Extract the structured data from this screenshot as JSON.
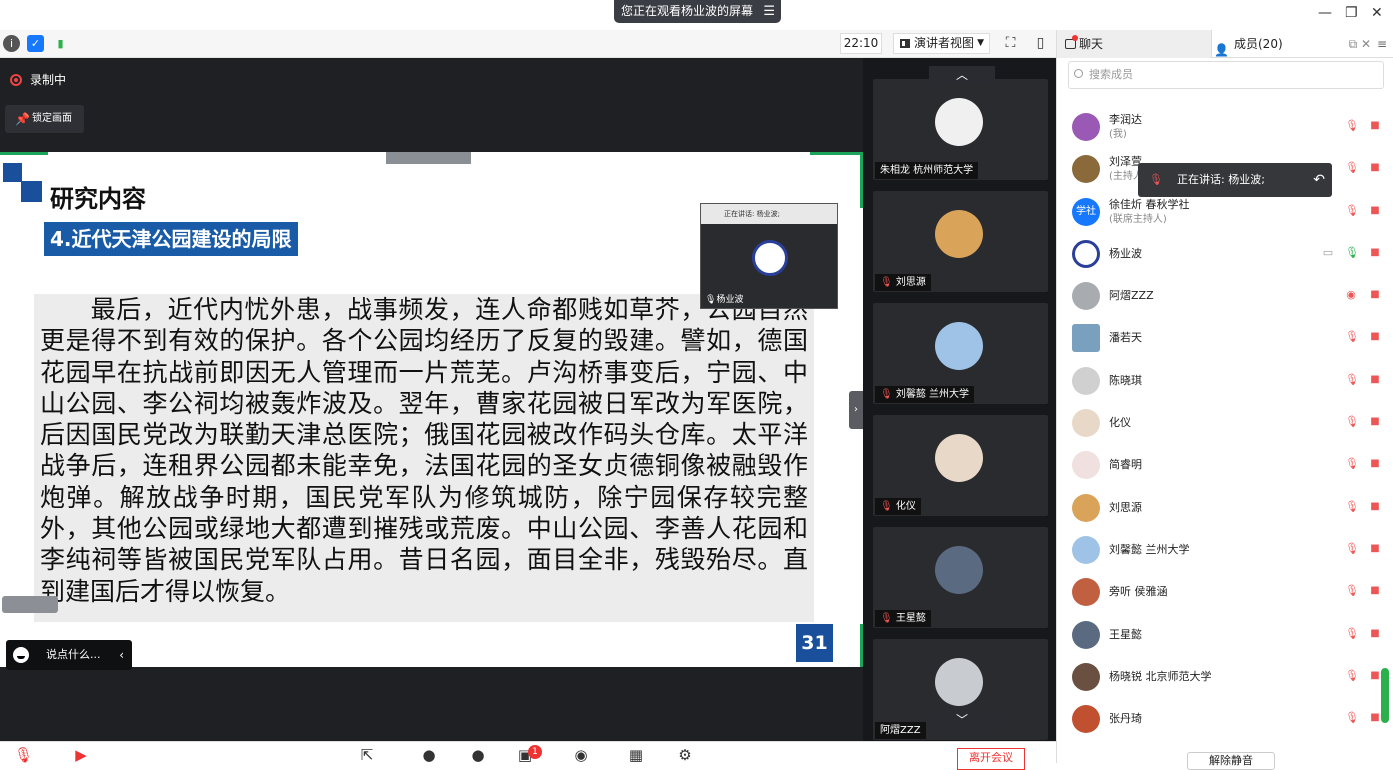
{
  "window": {
    "watching_banner": "您正在观看杨业波的屏幕",
    "menu_icon": "menu-icon",
    "minimize_icon": "minimize-icon",
    "restore_icon": "restore-icon",
    "close_icon": "close-icon"
  },
  "toolbar": {
    "time": "22:10",
    "view_mode": "演讲者视图",
    "icons": [
      "info-icon",
      "shield-icon",
      "signal-icon",
      "fullscreen-icon",
      "sidebar-toggle-icon"
    ]
  },
  "stage": {
    "recording_label": "录制中",
    "lock_label": "锁定画面",
    "chat_placeholder": "说点什么..."
  },
  "slide": {
    "title": "研究内容",
    "subtitle": "4.近代天津公园建设的局限",
    "body": "最后，近代内忧外患，战事频发，连人命都贱如草芥，公园自然更是得不到有效的保护。各个公园均经历了反复的毁建。譬如，德国花园早在抗战前即因无人管理而一片荒芜。卢沟桥事变后，宁园、中山公园、李公祠均被轰炸波及。翌年，曹家花园被日军改为军医院，后因国民党改为联勤天津总医院；俄国花园被改作码头仓库。太平洋战争后，连租界公园都未能幸免，法国花园的圣女贞德铜像被融毁作炮弹。解放战争时期，国民党军队为修筑城防，除宁园保存较完整外，其他公园或绿地大都遭到摧残或荒废。中山公园、李善人花园和李纯祠等皆被国民党军队占用。昔日名园，面目全非，残毁殆尽。直到建国后才得以恢复。",
    "page_number": "31"
  },
  "mini_window": {
    "header": "正在讲话: 杨业波;",
    "name": "杨业波"
  },
  "video_tiles": [
    {
      "label": "朱相龙 杭州师范大学",
      "color": "#f0f0f0"
    },
    {
      "label": "刘思源",
      "color": "#d9a45a"
    },
    {
      "label": "刘馨懿 兰州大学",
      "color": "#9ec3e6"
    },
    {
      "label": "化仪",
      "color": "#e8d8c8"
    },
    {
      "label": "王星懿",
      "color": "#5a6a80"
    },
    {
      "label": "阿熠ZZZ",
      "color": "#c8ccd0"
    }
  ],
  "panel": {
    "tab_chat": "聊天",
    "tab_members": "成员(20)",
    "search_placeholder": "搜索成员",
    "speaking_label": "正在讲话: 杨业波;",
    "unmute_all": "解除静音"
  },
  "members": [
    {
      "name": "李润达",
      "role": "(我)",
      "color": "#9b59b6"
    },
    {
      "name": "刘泽萱",
      "role": "(主持人)",
      "color": "#8a6a3a"
    },
    {
      "name": "徐佳炘 春秋学社",
      "role": "(联席主持人)",
      "color": "#1677ff",
      "avatar_text": "学社"
    },
    {
      "name": "杨业波",
      "role": "",
      "color": "#2a3f9a"
    },
    {
      "name": "阿熠ZZZ",
      "role": "",
      "color": "#a8acb0"
    },
    {
      "name": "潘若天",
      "role": "",
      "color": "#7aa0c0"
    },
    {
      "name": "陈晓琪",
      "role": "",
      "color": "#d0d0d0"
    },
    {
      "name": "化仪",
      "role": "",
      "color": "#e8d8c8"
    },
    {
      "name": "简睿明",
      "role": "",
      "color": "#f0e0e0"
    },
    {
      "name": "刘思源",
      "role": "",
      "color": "#d9a45a"
    },
    {
      "name": "刘馨懿 兰州大学",
      "role": "",
      "color": "#9ec3e6"
    },
    {
      "name": "旁听 侯雅涵",
      "role": "",
      "color": "#c06040"
    },
    {
      "name": "王星懿",
      "role": "",
      "color": "#5a6a80"
    },
    {
      "name": "杨晓锐 北京师范大学",
      "role": "",
      "color": "#6a5040"
    },
    {
      "name": "张丹琦",
      "role": "",
      "color": "#c05030"
    }
  ],
  "bottom": {
    "leave_label": "离开会议",
    "badge": "1"
  }
}
